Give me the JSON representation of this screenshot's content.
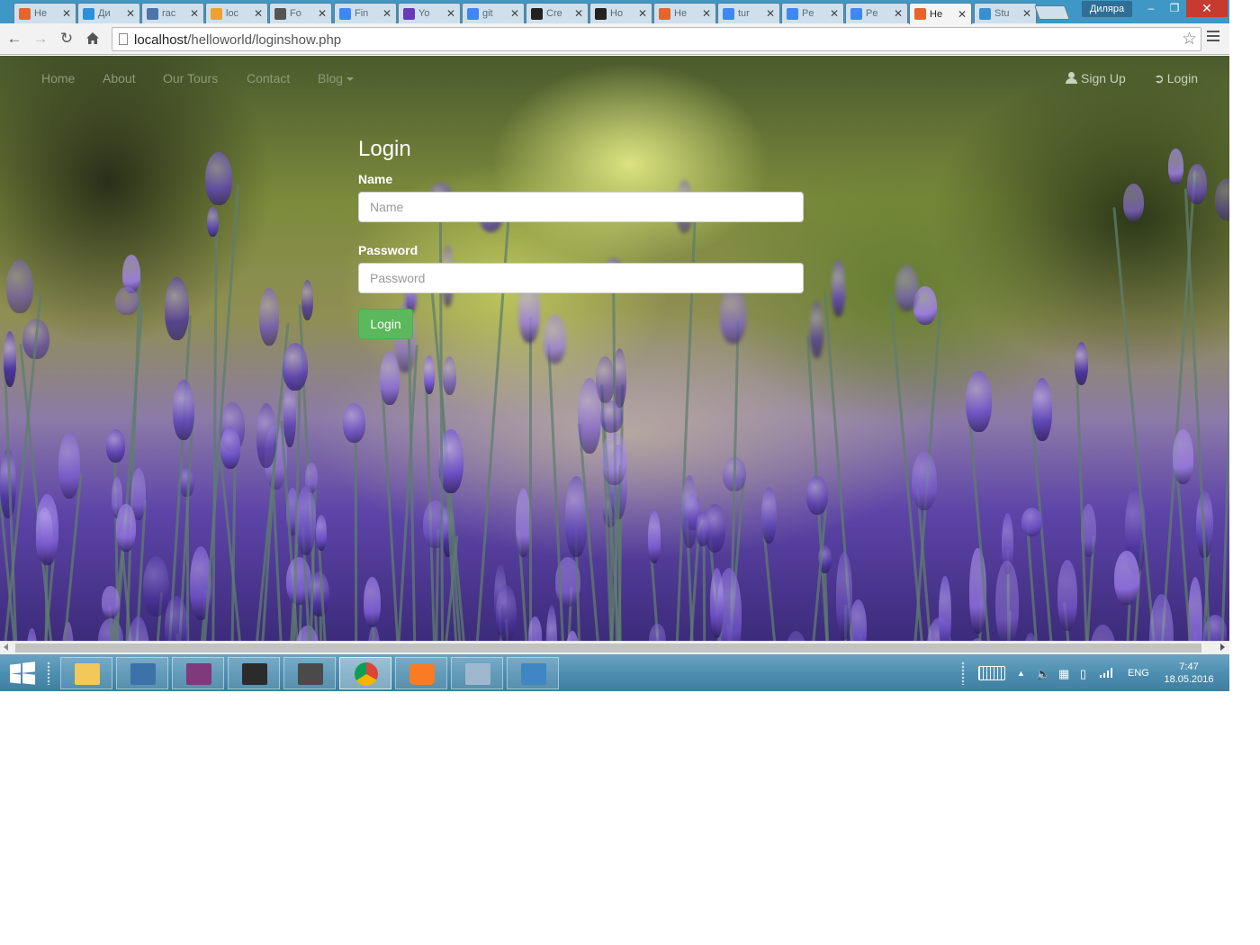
{
  "browser": {
    "tabs": [
      {
        "title": "He",
        "favicon_color": "#e8642a",
        "favicon_icon": "xampp-icon"
      },
      {
        "title": "Ди",
        "favicon_color": "#2f8fd8",
        "favicon_icon": "chat-icon"
      },
      {
        "title": "rac",
        "favicon_color": "#4a76a8",
        "favicon_icon": "vk-icon"
      },
      {
        "title": "loc",
        "favicon_color": "#f0a030",
        "favicon_icon": "phpmyadmin-icon"
      },
      {
        "title": "Fo",
        "favicon_color": "#555555",
        "favicon_icon": "contact-icon"
      },
      {
        "title": "Fin",
        "favicon_color": "#4285f4",
        "favicon_icon": "docs-icon"
      },
      {
        "title": "Yo",
        "favicon_color": "#673ab7",
        "favicon_icon": "forms-icon"
      },
      {
        "title": "git",
        "favicon_color": "#4285f4",
        "favicon_icon": "google-icon"
      },
      {
        "title": "Cre",
        "favicon_color": "#222222",
        "favicon_icon": "github-icon"
      },
      {
        "title": "Ho",
        "favicon_color": "#222222",
        "favicon_icon": "github-icon"
      },
      {
        "title": "He",
        "favicon_color": "#e8642a",
        "favicon_icon": "xampp-icon"
      },
      {
        "title": "tur",
        "favicon_color": "#4285f4",
        "favicon_icon": "google-icon"
      },
      {
        "title": "Pe",
        "favicon_color": "#4285f4",
        "favicon_icon": "google-icon"
      },
      {
        "title": "Pe",
        "favicon_color": "#4285f4",
        "favicon_icon": "google-icon"
      },
      {
        "title": "He",
        "favicon_color": "#e8642a",
        "favicon_icon": "xampp-icon",
        "active": true
      },
      {
        "title": "Stu",
        "favicon_color": "#3a8fd0",
        "favicon_icon": "studyfiles-icon"
      }
    ],
    "profile_name": "Диляра",
    "url_host": "localhost",
    "url_path": "/helloworld/loginshow.php"
  },
  "page": {
    "nav": {
      "home": "Home",
      "about": "About",
      "tours": "Our Tours",
      "contact": "Contact",
      "blog": "Blog",
      "signup": "Sign Up",
      "login": "Login"
    },
    "form": {
      "title": "Login",
      "name_label": "Name",
      "name_placeholder": "Name",
      "name_value": "",
      "password_label": "Password",
      "password_placeholder": "Password",
      "password_value": "",
      "submit_label": "Login"
    },
    "colors": {
      "primary_button": "#5cb85c",
      "nav_text": "#8d9a7a"
    }
  },
  "taskbar": {
    "apps": [
      {
        "name": "file-explorer",
        "icon": "folder-icon",
        "color": "#f2c85b"
      },
      {
        "name": "python",
        "icon": "python-icon",
        "color": "#3b73a8"
      },
      {
        "name": "onenote",
        "icon": "onenote-icon",
        "color": "#80397b"
      },
      {
        "name": "console",
        "icon": "console-icon",
        "color": "#2b2b2b"
      },
      {
        "name": "sublime-text",
        "icon": "sublime-icon",
        "color": "#4a4a4a"
      },
      {
        "name": "chrome",
        "icon": "chrome-icon",
        "color": "#db4437"
      },
      {
        "name": "xampp",
        "icon": "xampp-icon",
        "color": "#fb7a24"
      },
      {
        "name": "paint",
        "icon": "paint-icon",
        "color": "#9fb7cf"
      },
      {
        "name": "photos",
        "icon": "photo-viewer-icon",
        "color": "#3f86c4"
      }
    ],
    "language": "ENG",
    "time": "7:47",
    "date": "18.05.2016"
  }
}
